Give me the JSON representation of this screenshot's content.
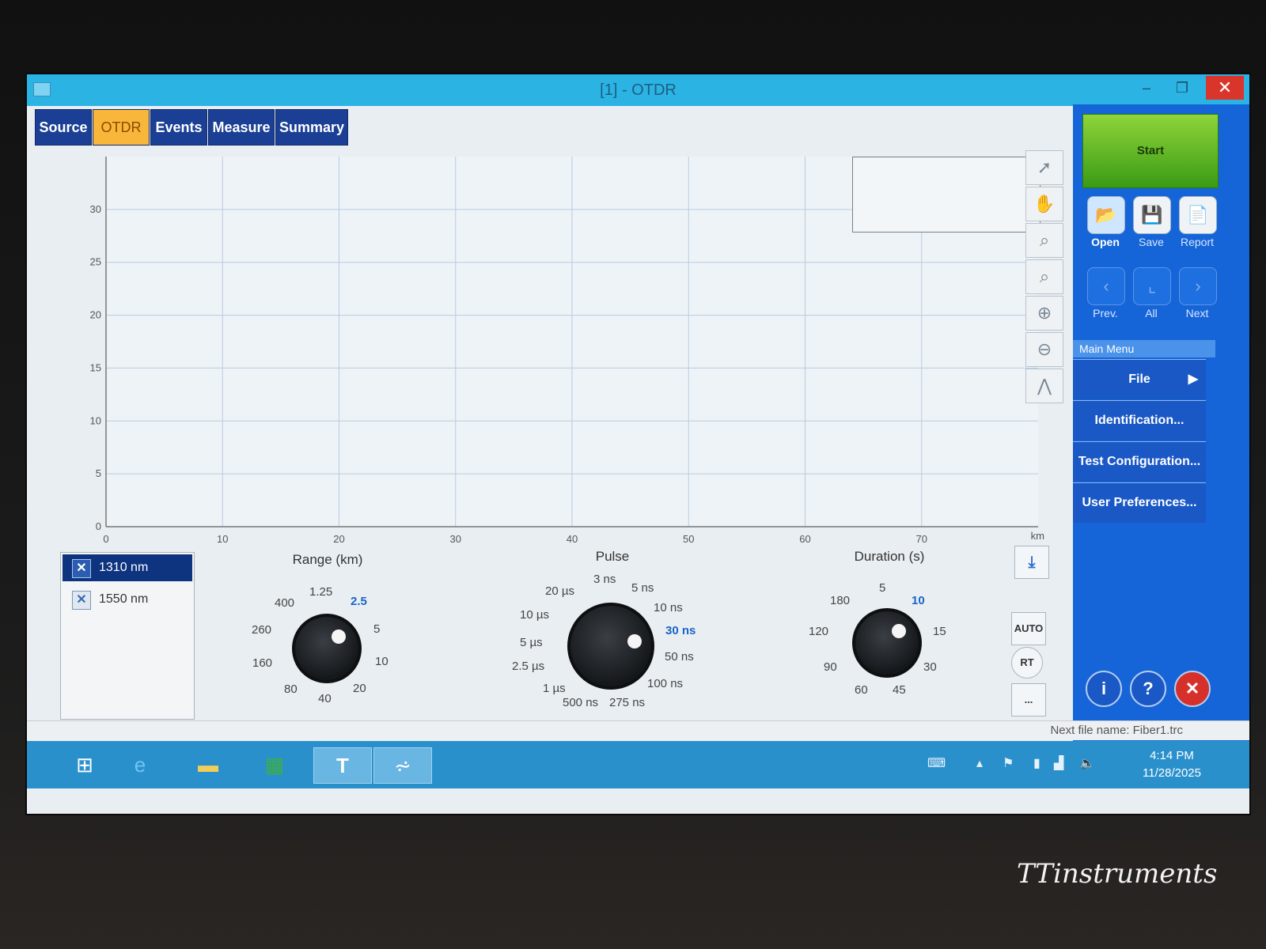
{
  "window": {
    "title": "[1] - OTDR",
    "min": "–",
    "max": "❐",
    "close": "✕"
  },
  "tabs": [
    {
      "label": "Source"
    },
    {
      "label": "OTDR"
    },
    {
      "label": "Events"
    },
    {
      "label": "Measure"
    },
    {
      "label": "Summary"
    }
  ],
  "chart_data": {
    "type": "line",
    "x_unit": "km",
    "xlim": [
      0,
      80
    ],
    "ylim": [
      0,
      35
    ],
    "xticks": [
      "0",
      "10",
      "20",
      "30",
      "40",
      "50",
      "60",
      "70"
    ],
    "yticks": [
      "0",
      "5",
      "10",
      "15",
      "20",
      "25",
      "30"
    ],
    "series": [],
    "grid": true
  },
  "toolbar_icons": [
    "pointer-icon",
    "hand-icon",
    "zoom-fit-icon",
    "zoom-reset-icon",
    "zoom-in-icon",
    "zoom-out-icon",
    "trace-icon"
  ],
  "right": {
    "start": "Start",
    "open": "Open",
    "save": "Save",
    "report": "Report",
    "prev": "Prev.",
    "all": "All",
    "next": "Next",
    "main_menu": "Main Menu",
    "menu": [
      "File",
      "Identification...",
      "Test Configuration...",
      "User Preferences..."
    ],
    "info": "i",
    "help": "?",
    "exit": "✕"
  },
  "wavelengths": [
    "1310 nm",
    "1550 nm"
  ],
  "range": {
    "title": "Range (km)",
    "labels": [
      "1.25",
      "2.5",
      "5",
      "10",
      "20",
      "40",
      "80",
      "160",
      "260",
      "400"
    ],
    "selected": "2.5"
  },
  "pulse": {
    "title": "Pulse",
    "labels": [
      "3 ns",
      "5 ns",
      "10 ns",
      "30 ns",
      "50 ns",
      "100 ns",
      "275 ns",
      "500 ns",
      "1 µs",
      "2.5 µs",
      "5 µs",
      "10 µs",
      "20 µs"
    ],
    "selected": "30 ns"
  },
  "duration": {
    "title": "Duration (s)",
    "labels": [
      "5",
      "10",
      "15",
      "30",
      "45",
      "60",
      "90",
      "120",
      "180"
    ],
    "selected": "10"
  },
  "side": {
    "auto": "AUTO",
    "rt": "RT",
    "more": "..."
  },
  "status": {
    "next_file": "Next file name: Fiber1.trc"
  },
  "taskbar": {
    "time": "4:14 PM",
    "date": "11/28/2025"
  },
  "watermark": "TTinstruments"
}
